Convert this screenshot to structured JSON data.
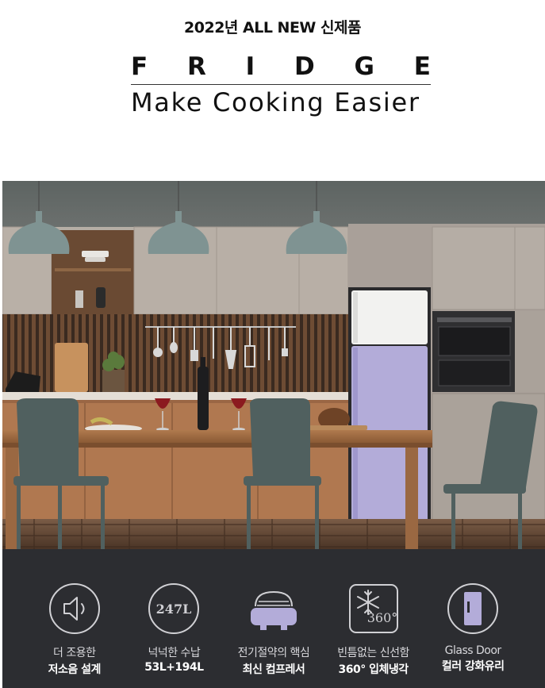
{
  "header": {
    "tagline": "2022년 ALL NEW 신제품",
    "brand_letters": [
      "F",
      "R",
      "I",
      "D",
      "G",
      "E"
    ],
    "slogan": "Make Cooking Easier"
  },
  "scene": {
    "fridge_top_color": "#f2f2f0",
    "fridge_bottom_color": "#b3acd9",
    "accent_color": "#b3acd9"
  },
  "features": [
    {
      "icon": "speaker-icon",
      "line1": "더 조용한",
      "line2": "저소음 설계"
    },
    {
      "icon": "capacity-icon",
      "icon_text": "247L",
      "line1": "넉넉한 수납",
      "line2": "53L+194L"
    },
    {
      "icon": "compressor-icon",
      "line1": "전기절약의 핵심",
      "line2": "최신 컴프레서"
    },
    {
      "icon": "snowflake-icon",
      "icon_text": "360°",
      "line1": "빈틈없는 신선함",
      "line2": "360° 입체냉각"
    },
    {
      "icon": "glass-door-icon",
      "line1": "Glass Door",
      "line2": "컬러 강화유리"
    }
  ]
}
